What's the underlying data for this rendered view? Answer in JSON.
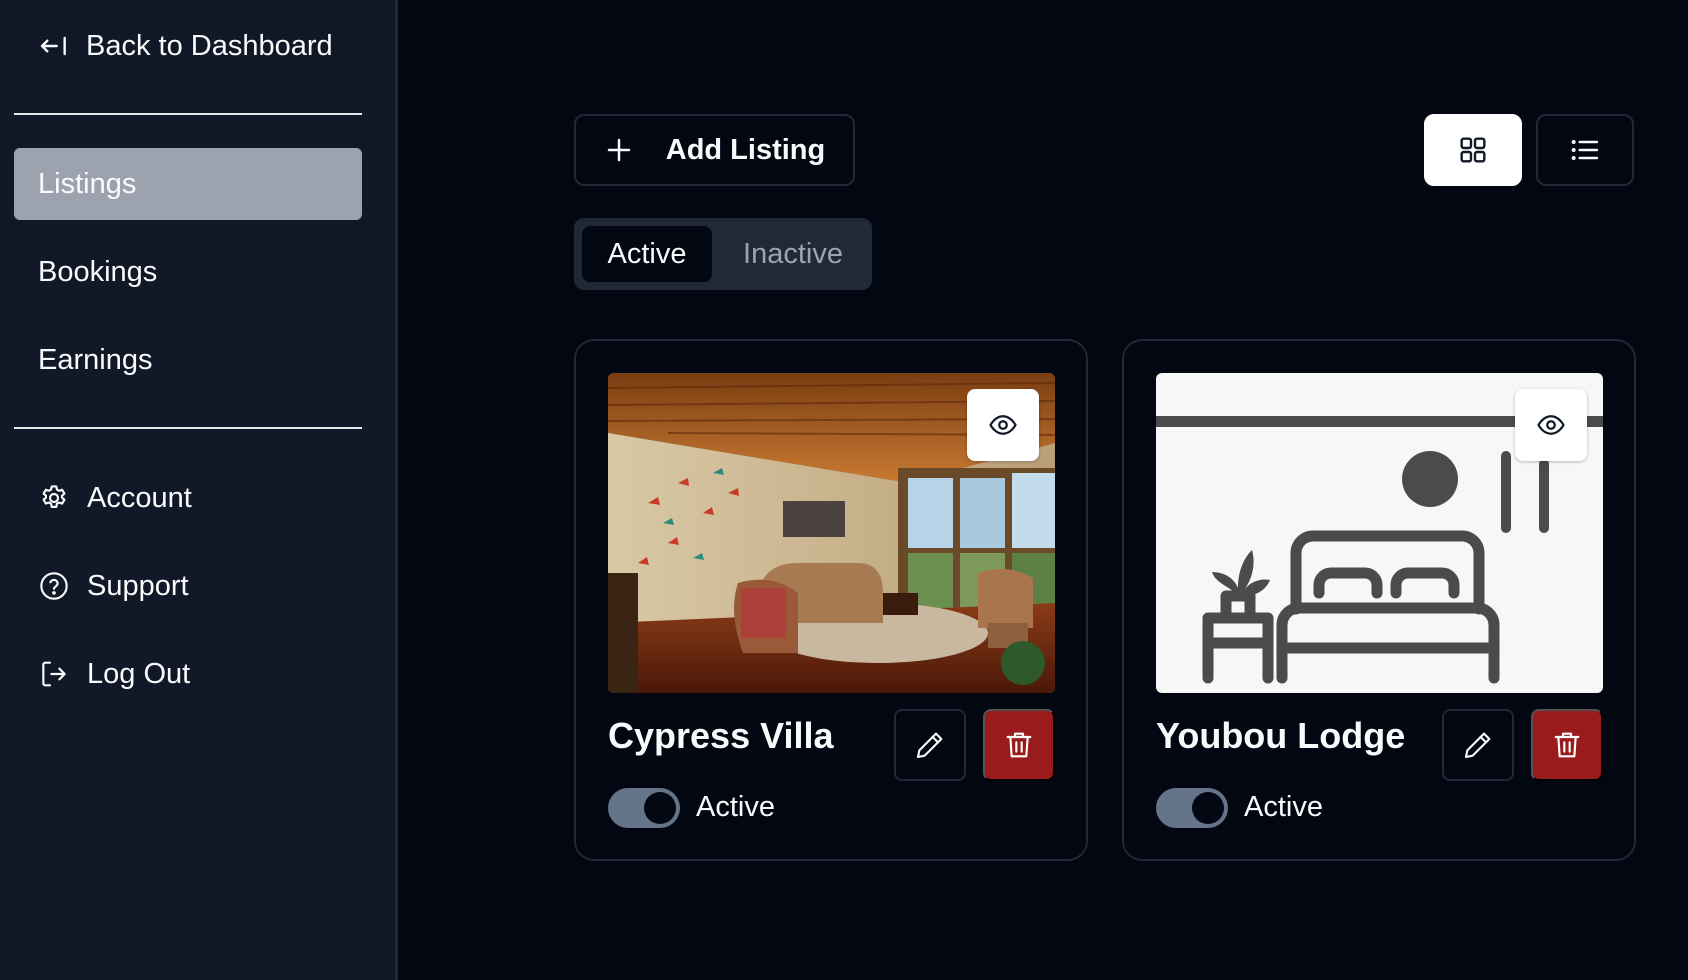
{
  "sidebar": {
    "back_label": "Back to Dashboard",
    "items": [
      {
        "label": "Listings",
        "selected": true
      },
      {
        "label": "Bookings"
      },
      {
        "label": "Earnings"
      },
      {
        "label": "Account",
        "icon": "gear-icon"
      },
      {
        "label": "Support",
        "icon": "help-circle-icon"
      },
      {
        "label": "Log Out",
        "icon": "logout-icon"
      }
    ]
  },
  "toolbar": {
    "add_label": "Add Listing",
    "view_modes": [
      {
        "name": "grid-view",
        "icon": "grid-icon",
        "active": true
      },
      {
        "name": "list-view",
        "icon": "list-icon",
        "active": false
      }
    ]
  },
  "tabs": [
    {
      "label": "Active",
      "selected": true
    },
    {
      "label": "Inactive",
      "selected": false
    }
  ],
  "listings": [
    {
      "title": "Cypress Villa",
      "status_label": "Active",
      "active": true,
      "image": "living-room-photo"
    },
    {
      "title": "Youbou Lodge",
      "status_label": "Active",
      "active": true,
      "image": "bedroom-placeholder-illustration"
    }
  ],
  "colors": {
    "background": "#030712",
    "sidebar": "#111827",
    "selected_nav": "#9ca3af",
    "delete": "#991b1b",
    "toggle_track": "#64748b"
  }
}
